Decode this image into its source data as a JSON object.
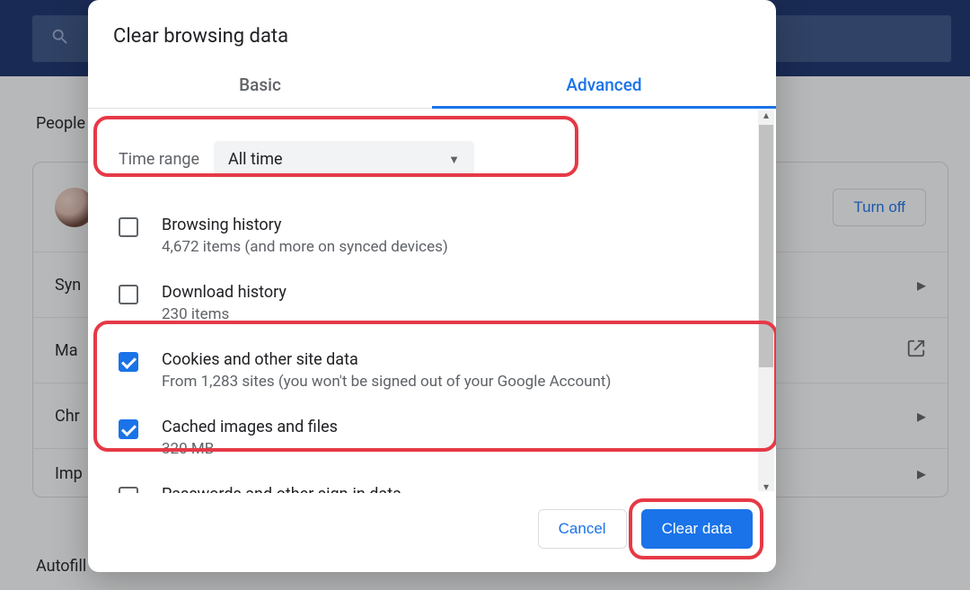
{
  "bg": {
    "section_people": "People",
    "section_autofill": "Autofill",
    "rows": {
      "sync_label_partial": "Syn",
      "manage_label_partial": "Ma",
      "chrome_label_partial": "Chr",
      "import_label_partial": "Imp"
    },
    "turn_off": "Turn off"
  },
  "dialog": {
    "title": "Clear browsing data",
    "tabs": {
      "basic": "Basic",
      "advanced": "Advanced"
    },
    "time_range_label": "Time range",
    "time_range_value": "All time",
    "items": [
      {
        "checked": false,
        "title": "Browsing history",
        "subtitle": "4,672 items (and more on synced devices)"
      },
      {
        "checked": false,
        "title": "Download history",
        "subtitle": "230 items"
      },
      {
        "checked": true,
        "title": "Cookies and other site data",
        "subtitle": "From 1,283 sites (you won't be signed out of your Google Account)"
      },
      {
        "checked": true,
        "title": "Cached images and files",
        "subtitle": "320 MB"
      },
      {
        "checked": false,
        "title": "Passwords and other sign-in data",
        "subtitle": ""
      }
    ],
    "cancel": "Cancel",
    "clear": "Clear data"
  }
}
